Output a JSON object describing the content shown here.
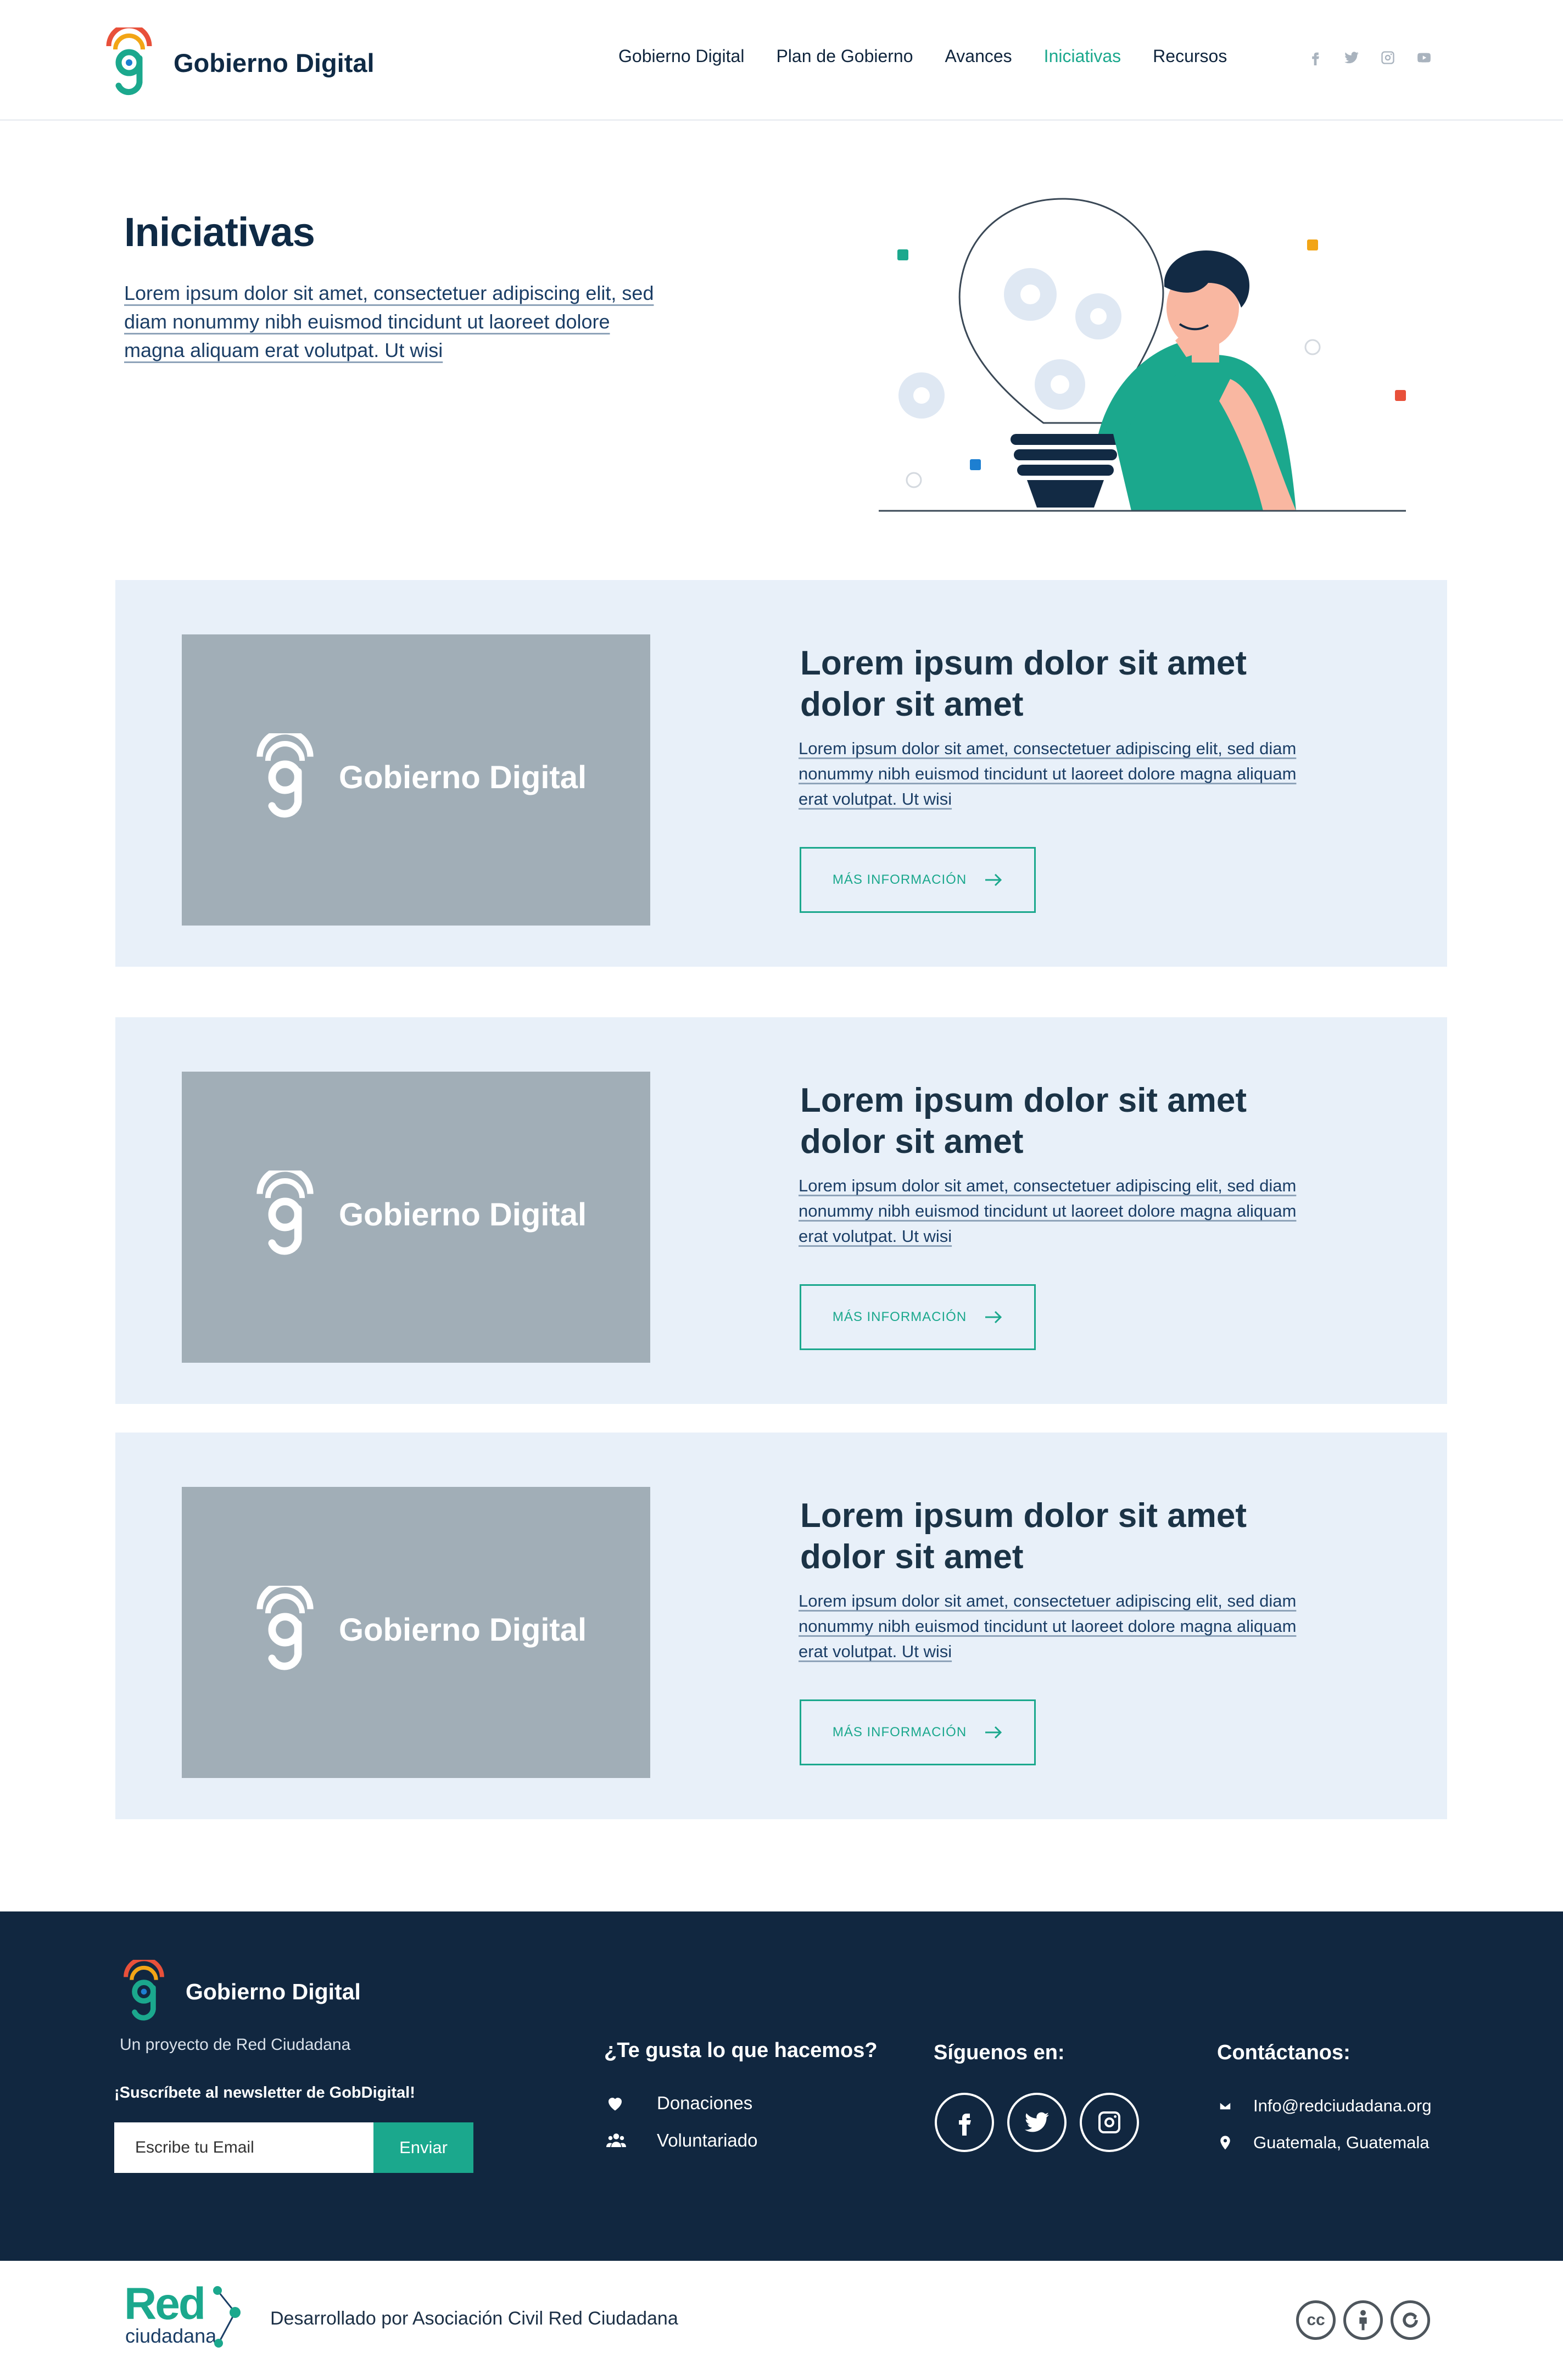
{
  "header": {
    "logo_text": "Gobierno Digital",
    "nav": [
      "Gobierno Digital",
      "Plan de Gobierno",
      "Avances",
      "Iniciativas",
      "Recursos"
    ],
    "active_nav": "Iniciativas",
    "social_icons": [
      "facebook-icon",
      "twitter-icon",
      "instagram-icon",
      "youtube-icon"
    ]
  },
  "hero": {
    "title": "Iniciativas",
    "text": "Lorem ipsum dolor sit amet, consectetuer adipiscing elit, sed diam nonummy nibh euismod tincidunt ut laoreet dolore magna aliquam erat volutpat. Ut wisi"
  },
  "cards": [
    {
      "image_text": "Gobierno Digital",
      "title": "Lorem ipsum dolor sit amet dolor sit amet",
      "desc": "Lorem ipsum dolor sit amet, consectetuer adipiscing elit, sed diam nonummy nibh euismod tincidunt ut laoreet dolore magna aliquam erat volutpat. Ut wisi",
      "button": "MÁS INFORMACIÓN"
    },
    {
      "image_text": "Gobierno Digital",
      "title": "Lorem ipsum dolor sit amet dolor sit amet",
      "desc": "Lorem ipsum dolor sit amet, consectetuer adipiscing elit, sed diam nonummy nibh euismod tincidunt ut laoreet dolore magna aliquam erat volutpat. Ut wisi",
      "button": "MÁS INFORMACIÓN"
    },
    {
      "image_text": "Gobierno Digital",
      "title": "Lorem ipsum dolor sit amet dolor sit amet",
      "desc": "Lorem ipsum dolor sit amet, consectetuer adipiscing elit, sed diam nonummy nibh euismod tincidunt ut laoreet dolore magna aliquam erat volutpat. Ut wisi",
      "button": "MÁS INFORMACIÓN"
    }
  ],
  "footer": {
    "logo_text": "Gobierno Digital",
    "subtitle": "Un proyecto de Red Ciudadana",
    "newsletter_label": "¡Suscríbete al newsletter de GobDigital!",
    "email_placeholder": "Escribe tu Email",
    "send_label": "Enviar",
    "support_heading": "¿Te gusta lo que hacemos?",
    "support_links": [
      {
        "icon": "heart-icon",
        "label": "Donaciones"
      },
      {
        "icon": "users-icon",
        "label": "Voluntariado"
      }
    ],
    "follow_heading": "Síguenos en:",
    "follow_icons": [
      "facebook-icon",
      "twitter-icon",
      "instagram-icon"
    ],
    "contact_heading": "Contáctanos:",
    "contact": [
      {
        "icon": "mail-icon",
        "label": "Info@redciudadana.org"
      },
      {
        "icon": "location-pin-icon",
        "label": "Guatemala, Guatemala"
      }
    ]
  },
  "bottom": {
    "org_logo_word": "Red",
    "org_logo_sub": "ciudadana",
    "developed_by": "Desarrollado por Asociación Civil Red Ciudadana",
    "license_icons": [
      "cc-icon",
      "attribution-icon",
      "share-alike-icon"
    ]
  },
  "colors": {
    "accent": "#1ba88d",
    "navy": "#112740",
    "card_bg": "#e8f0f9",
    "placeholder_image": "#a1aeb7"
  }
}
